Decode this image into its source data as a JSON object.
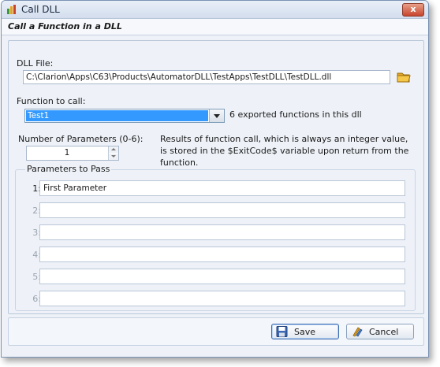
{
  "window": {
    "title": "Call DLL",
    "subtitle": "Call a Function in a DLL",
    "close_label": "x"
  },
  "dll_file": {
    "label": "DLL File:",
    "value": "C:\\Clarion\\Apps\\C63\\Products\\AutomatorDLL\\TestApps\\TestDLL\\TestDLL.dll"
  },
  "function": {
    "label": "Function to call:",
    "selected": "Test1",
    "info": "6 exported functions in this dll"
  },
  "num_params": {
    "label": "Number of Parameters (0-6):",
    "value": "1"
  },
  "results_note": {
    "line1": "Results of function call, which is always an integer value,",
    "line2": "is stored in the $ExitCode$ variable upon return from the",
    "line3": "function."
  },
  "params_group": {
    "title": "Parameters to Pass",
    "rows": [
      {
        "num": "1:",
        "value": "First Parameter"
      },
      {
        "num": "2:",
        "value": ""
      },
      {
        "num": "3:",
        "value": ""
      },
      {
        "num": "4:",
        "value": ""
      },
      {
        "num": "5:",
        "value": ""
      },
      {
        "num": "6:",
        "value": ""
      }
    ]
  },
  "buttons": {
    "save": "Save",
    "cancel": "Cancel"
  },
  "colors": {
    "selection": "#3399ff",
    "window_bg": "#eef2f8",
    "close": "#c8452d"
  },
  "icons": {
    "app": "app-icon",
    "folder": "folder-icon",
    "save": "save-icon",
    "cancel": "cancel-icon"
  }
}
